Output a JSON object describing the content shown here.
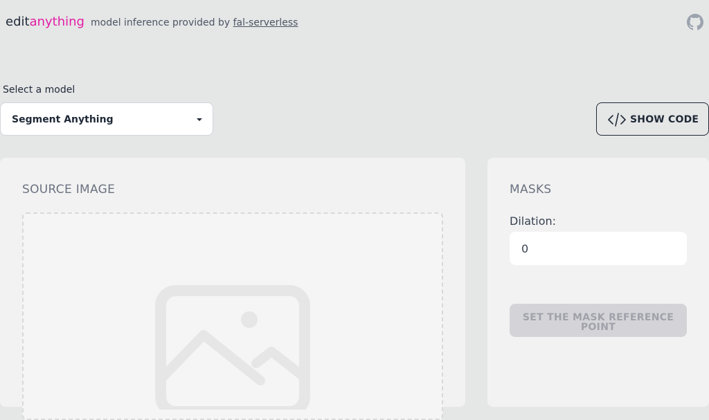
{
  "header": {
    "brand_part1": "edit",
    "brand_part2": "anything",
    "tagline_prefix": "model inference provided by",
    "tagline_link": "fal-serverless",
    "github_icon": "github-icon",
    "brand_accent_color": "#e21fa5"
  },
  "model_selector": {
    "label": "Select a model",
    "selected": "Segment Anything"
  },
  "show_code": {
    "label": "SHOW CODE",
    "icon": "code-icon"
  },
  "source_panel": {
    "title": "SOURCE IMAGE",
    "placeholder_icon": "image-placeholder-icon"
  },
  "masks_panel": {
    "title": "MASKS",
    "dilation_label": "Dilation:",
    "dilation_value": "0",
    "mask_button_label": "SET THE MASK REFERENCE POINT"
  }
}
